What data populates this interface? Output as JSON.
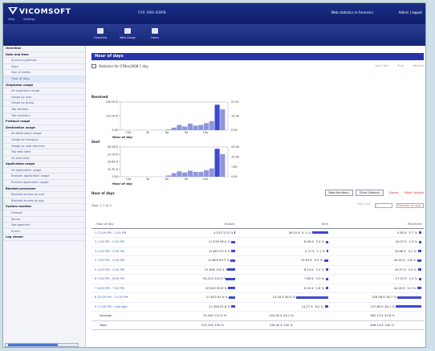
{
  "brand": {
    "name": "VICOMSOFT"
  },
  "topbar": {
    "center_text": "FOR: WEB ADMIN",
    "right_items": [
      "Web statistics in Forensics",
      "Admin | logout"
    ],
    "sublinks": [
      "Help",
      "Settings"
    ]
  },
  "toolbar": {
    "buttons": [
      "Overview",
      "Web Usage",
      "Users"
    ]
  },
  "sidebar": {
    "items": [
      {
        "label": "Overview",
        "level": 0
      },
      {
        "label": "Date and time",
        "level": 0
      },
      {
        "label": "Summary/Activity",
        "level": 1
      },
      {
        "label": "Days",
        "level": 1
      },
      {
        "label": "Day of weeks",
        "level": 1
      },
      {
        "label": "Hour of days",
        "level": 1,
        "selected": true
      },
      {
        "label": "Originator usage",
        "level": 0
      },
      {
        "label": "All originator usage",
        "level": 1
      },
      {
        "label": "Usage by user",
        "level": 1
      },
      {
        "label": "Usage by group",
        "level": 1
      },
      {
        "label": "Top senders",
        "level": 1
      },
      {
        "label": "Top receivers",
        "level": 1
      },
      {
        "label": "Protocol usage",
        "level": 0
      },
      {
        "label": "Destination usage",
        "level": 0
      },
      {
        "label": "All destination usage",
        "level": 1
      },
      {
        "label": "Usage by category",
        "level": 1
      },
      {
        "label": "Usage by web domains",
        "level": 1
      },
      {
        "label": "Top web sites",
        "level": 1
      },
      {
        "label": "All web sites",
        "level": 1
      },
      {
        "label": "Application usage",
        "level": 0
      },
      {
        "label": "All application usage",
        "level": 1
      },
      {
        "label": "Browser application usage",
        "level": 1
      },
      {
        "label": "Process application usage",
        "level": 1
      },
      {
        "label": "Blocked processes",
        "level": 0
      },
      {
        "label": "Blocked access by user",
        "level": 1
      },
      {
        "label": "Blocked access by app",
        "level": 1
      },
      {
        "label": "System monitor",
        "level": 0
      },
      {
        "label": "Firewall",
        "level": 1
      },
      {
        "label": "Server",
        "level": 1
      },
      {
        "label": "Management",
        "level": 1
      },
      {
        "label": "Errors",
        "level": 1
      },
      {
        "label": "Log viewer",
        "level": 0
      }
    ]
  },
  "page": {
    "title": "Hour of days",
    "stats_line": "Statistics for 07Nov2008 1 day",
    "actions": [
      "Save Rpt",
      "Print",
      "Refresh"
    ]
  },
  "charts": {
    "received_label": "Received",
    "sent_label": "Sent"
  },
  "chart_data": [
    {
      "type": "bar",
      "title": "Received",
      "xlabel": "Hour of day",
      "x_ticks": [
        "12a",
        "3a",
        "6a",
        "9a",
        "12p"
      ],
      "y_ticks": [
        "250.00 K",
        "125.00 K",
        "0.00"
      ],
      "right_ticks": [
        "21.92",
        "14.38",
        "0.00"
      ],
      "ylim": [
        0,
        250
      ],
      "values": [
        0,
        0,
        0,
        0,
        0,
        0,
        0,
        0,
        6,
        22,
        46,
        32,
        58,
        40,
        46,
        62,
        80,
        175,
        185
      ],
      "highlight_index": 17,
      "highlight_value": 226
    },
    {
      "type": "bar",
      "title": "Sent",
      "xlabel": "Hour of day",
      "x_ticks": [
        "12a",
        "3a",
        "6a",
        "9a",
        "12p"
      ],
      "y_ticks": [
        "49.28 K",
        "37.00 K",
        "24.64 K",
        "12.32 K",
        "0.00"
      ],
      "right_ticks": [
        "23.08",
        "15.38",
        "7.69",
        "0.00"
      ],
      "ylim": [
        0,
        50
      ],
      "values": [
        0,
        0,
        0,
        0,
        0,
        0,
        0,
        0,
        2,
        6,
        9,
        7,
        10,
        8,
        8,
        11,
        14,
        37,
        38
      ],
      "highlight_index": 17,
      "highlight_value": 47
    }
  ],
  "section": {
    "title": "Hour of days",
    "tabs": [
      "Raw Numbers",
      "Chart Options"
    ],
    "links": [
      "Export",
      "Table Options"
    ],
    "pager_info": "Page 1, 1 of 4",
    "pager_label": "Page size",
    "page_value": "1",
    "pager_select": "Number of rows"
  },
  "table": {
    "headers": [
      "Hour of day",
      "Visitors",
      "Sent",
      "Received"
    ],
    "rows": [
      [
        "1   12:00 PM - 1:00 PM",
        "4,570",
        "22.5 %",
        "26.53 K",
        "11.1 %",
        "5.85 K",
        "0.7 %"
      ],
      [
        "2   1:00 PM - 2:00 PM",
        "11,576",
        "56.0 %",
        "8.08 K",
        "3.4 %",
        "16.07 K",
        "1.9 %"
      ],
      [
        "3   2:00 PM - 3:00 PM",
        "11,603",
        "53.9 %",
        "2.71 K",
        "1.1 %",
        "34.86 K",
        "4.1 %"
      ],
      [
        "4   3:00 PM - 4:00 PM",
        "13,606",
        "63.3 %",
        "15.63 K",
        "6.5 %",
        "40.42 K",
        "4.8 %"
      ],
      [
        "5   4:00 PM - 5:00 PM",
        "22,658",
        "105.4 %",
        "8.14 K",
        "3.4 %",
        "29.57 K",
        "3.5 %"
      ],
      [
        "6   5:00 PM - 6:00 PM",
        "26,224",
        "122.0 %",
        "7.80 K",
        "3.3 %",
        "17.23 K",
        "2.0 %"
      ],
      [
        "7   6:00 PM - 7:00 PM",
        "20,545",
        "95.6 %",
        "6.34 K",
        "2.6 %",
        "44.20 K",
        "5.2 %"
      ],
      [
        "8   10:00 PM - 11:00 PM",
        "17,832",
        "83.0 %",
        "15.44 K",
        "48.5 %",
        "226.08 K",
        "26.7 %"
      ],
      [
        "9   11:00 PM - midnight",
        "11,358",
        "52.8 %",
        "14.27 K",
        "6.0 %",
        "237.85 K",
        "28.1 %"
      ]
    ],
    "bars": [
      [
        1,
        20,
        3
      ],
      [
        5,
        3,
        3
      ],
      [
        5,
        2,
        4
      ],
      [
        6,
        5,
        5
      ],
      [
        10,
        3,
        4
      ],
      [
        12,
        3,
        3
      ],
      [
        9,
        3,
        5
      ],
      [
        8,
        40,
        30
      ],
      [
        5,
        4,
        32
      ]
    ],
    "average": [
      "Average",
      "14,440",
      "111.0 %",
      "104.40 K",
      "44.1 %",
      "462.14 K",
      "54.6 %"
    ],
    "total": [
      "Total",
      "215,295",
      "100 %",
      "236.40 K",
      "100 %",
      "846.14 K",
      "100 %"
    ]
  }
}
